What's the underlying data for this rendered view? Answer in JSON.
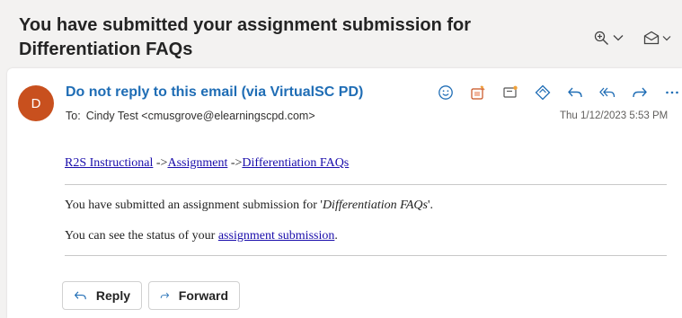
{
  "subject": {
    "line1": "You have submitted your assignment submission for",
    "line2": "Differentiation FAQs"
  },
  "header_icons": [
    "zoom-icon",
    "chevron-down-icon",
    "mark-icon",
    "chevron-down-icon"
  ],
  "sender": {
    "avatar_initial": "D",
    "avatar_color": "#c8501e",
    "name": "Do not reply to this email (via VirtualSC PD)",
    "to_label": "To:",
    "to_value": "Cindy Test <cmusgrove@elearningscpd.com>",
    "date": "Thu 1/12/2023 5:53 PM"
  },
  "message_actions": [
    "emoji-icon",
    "apps-icon",
    "flag-icon",
    "tag-icon",
    "reply-icon",
    "reply-all-icon",
    "forward-icon",
    "more-icon"
  ],
  "body": {
    "crumb1": "R2S Instructional",
    "sep1": " ->",
    "crumb2": "Assignment",
    "sep2": " ->",
    "crumb3": "Differentiation FAQs",
    "p1_prefix": "You have submitted an assignment submission for '",
    "p1_italic": "Differentiation FAQs",
    "p1_suffix": "'.",
    "p2_prefix": "You can see the status of your ",
    "p2_link": "assignment submission",
    "p2_suffix": "."
  },
  "buttons": {
    "reply": "Reply",
    "forward": "Forward"
  },
  "colors": {
    "accent": "#1f6db5",
    "link": "#1a0dab",
    "background": "#f3f2f1"
  }
}
